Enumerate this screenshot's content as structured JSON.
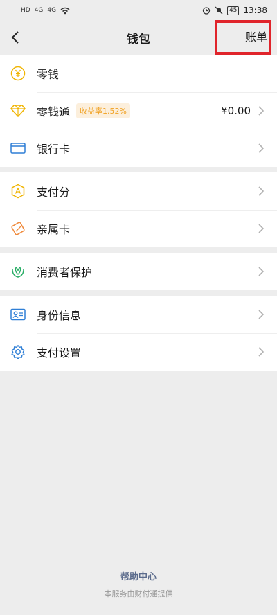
{
  "status_bar": {
    "left": [
      "HD",
      "4G",
      "4G"
    ],
    "battery": "45",
    "time": "13:38"
  },
  "nav": {
    "title": "钱包",
    "bill_label": "账单"
  },
  "groups": [
    [
      {
        "icon": "yen-coin-icon",
        "label": "零钱"
      },
      {
        "icon": "diamond-icon",
        "label": "零钱通",
        "badge": "收益率1.52%",
        "value": "¥0.00"
      },
      {
        "icon": "bank-card-icon",
        "label": "银行卡"
      }
    ],
    [
      {
        "icon": "pay-score-icon",
        "label": "支付分"
      },
      {
        "icon": "family-card-icon",
        "label": "亲属卡"
      }
    ],
    [
      {
        "icon": "consumer-protection-icon",
        "label": "消费者保护"
      }
    ],
    [
      {
        "icon": "id-card-icon",
        "label": "身份信息"
      },
      {
        "icon": "settings-gear-icon",
        "label": "支付设置"
      }
    ]
  ],
  "footer": {
    "help": "帮助中心",
    "provided_by": "本服务由财付通提供"
  },
  "colors": {
    "background": "#ededed",
    "accent_yellow": "#f0b400",
    "accent_blue": "#2f7fd6",
    "accent_green": "#2aae67",
    "highlight_red": "#e0242b"
  }
}
